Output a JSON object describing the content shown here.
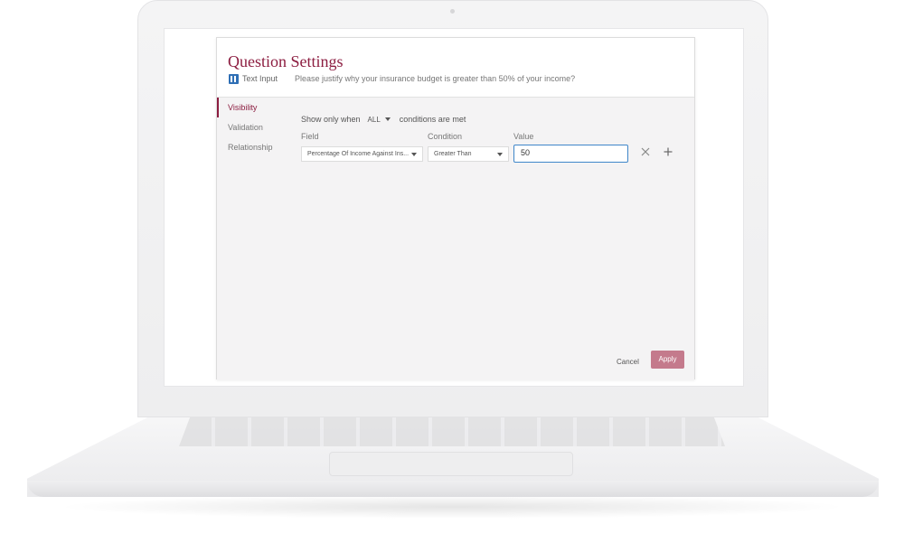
{
  "dialog": {
    "title": "Question Settings",
    "question_type": "Text Input",
    "question_text": "Please justify why your insurance budget is greater than 50% of your income?"
  },
  "nav": {
    "items": [
      {
        "label": "Visibility",
        "active": true
      },
      {
        "label": "Validation",
        "active": false
      },
      {
        "label": "Relationship",
        "active": false
      }
    ]
  },
  "rule": {
    "prefix": "Show only when",
    "match_mode": "ALL",
    "suffix": "conditions are met",
    "columns": {
      "field": "Field",
      "condition": "Condition",
      "value": "Value"
    },
    "field_value": "Percentage Of Income Against Ins...",
    "condition_value": "Greater Than",
    "value_value": "50"
  },
  "icons": {
    "remove": "close-icon",
    "add": "plus-icon",
    "type": "text-input-icon"
  },
  "actions": {
    "cancel": "Cancel",
    "apply": "Apply"
  },
  "colors": {
    "brand": "#8c1d40",
    "apply": "#c47a8c",
    "focus": "#3f86c9"
  }
}
